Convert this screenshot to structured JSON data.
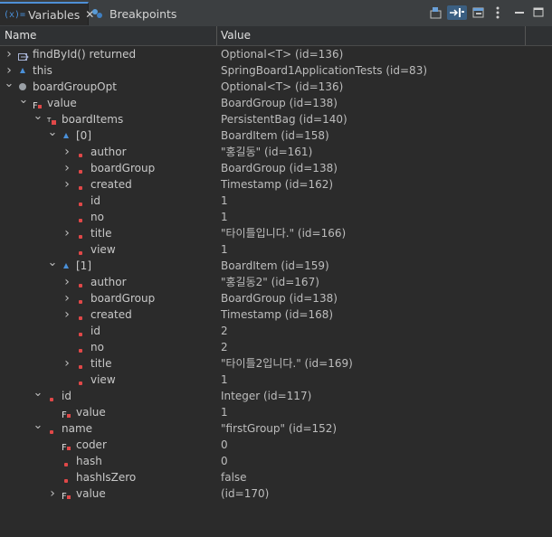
{
  "tabs": {
    "variables_label": "Variables",
    "variables_prefix": "(x)=",
    "breakpoints_label": "Breakpoints"
  },
  "columns": {
    "name": "Name",
    "value": "Value"
  },
  "rows": [
    {
      "name": "findById() returned",
      "value": "Optional<T>  (id=136)",
      "depth": 0,
      "exp": "collapsed",
      "icon": "return"
    },
    {
      "name": "this",
      "value": "SpringBoard1ApplicationTests  (id=83)",
      "depth": 0,
      "exp": "collapsed",
      "icon": "tri"
    },
    {
      "name": "boardGroupOpt",
      "value": "Optional<T>  (id=136)",
      "depth": 0,
      "exp": "expanded",
      "icon": "circle"
    },
    {
      "name": "value",
      "value": "BoardGroup  (id=138)",
      "depth": 1,
      "exp": "expanded",
      "icon": "final"
    },
    {
      "name": "boardItems",
      "value": "PersistentBag  (id=140)",
      "depth": 2,
      "exp": "expanded",
      "icon": "transient"
    },
    {
      "name": "[0]",
      "value": "BoardItem  (id=158)",
      "depth": 3,
      "exp": "expanded",
      "icon": "tri"
    },
    {
      "name": "author",
      "value": "\"홍길동\" (id=161)",
      "depth": 4,
      "exp": "collapsed",
      "icon": "red"
    },
    {
      "name": "boardGroup",
      "value": "BoardGroup  (id=138)",
      "depth": 4,
      "exp": "collapsed",
      "icon": "red"
    },
    {
      "name": "created",
      "value": "Timestamp  (id=162)",
      "depth": 4,
      "exp": "collapsed",
      "icon": "red"
    },
    {
      "name": "id",
      "value": "1",
      "depth": 4,
      "exp": "none",
      "icon": "red"
    },
    {
      "name": "no",
      "value": "1",
      "depth": 4,
      "exp": "none",
      "icon": "red"
    },
    {
      "name": "title",
      "value": "\"타이틀입니다.\" (id=166)",
      "depth": 4,
      "exp": "collapsed",
      "icon": "red"
    },
    {
      "name": "view",
      "value": "1",
      "depth": 4,
      "exp": "none",
      "icon": "red"
    },
    {
      "name": "[1]",
      "value": "BoardItem  (id=159)",
      "depth": 3,
      "exp": "expanded",
      "icon": "tri"
    },
    {
      "name": "author",
      "value": "\"홍길동2\" (id=167)",
      "depth": 4,
      "exp": "collapsed",
      "icon": "red"
    },
    {
      "name": "boardGroup",
      "value": "BoardGroup  (id=138)",
      "depth": 4,
      "exp": "collapsed",
      "icon": "red"
    },
    {
      "name": "created",
      "value": "Timestamp  (id=168)",
      "depth": 4,
      "exp": "collapsed",
      "icon": "red"
    },
    {
      "name": "id",
      "value": "2",
      "depth": 4,
      "exp": "none",
      "icon": "red"
    },
    {
      "name": "no",
      "value": "2",
      "depth": 4,
      "exp": "none",
      "icon": "red"
    },
    {
      "name": "title",
      "value": "\"타이틀2입니다.\" (id=169)",
      "depth": 4,
      "exp": "collapsed",
      "icon": "red"
    },
    {
      "name": "view",
      "value": "1",
      "depth": 4,
      "exp": "none",
      "icon": "red"
    },
    {
      "name": "id",
      "value": "Integer  (id=117)",
      "depth": 2,
      "exp": "expanded",
      "icon": "red"
    },
    {
      "name": "value",
      "value": "1",
      "depth": 3,
      "exp": "none",
      "icon": "final"
    },
    {
      "name": "name",
      "value": "\"firstGroup\" (id=152)",
      "depth": 2,
      "exp": "expanded",
      "icon": "red"
    },
    {
      "name": "coder",
      "value": "0",
      "depth": 3,
      "exp": "none",
      "icon": "final"
    },
    {
      "name": "hash",
      "value": "0",
      "depth": 3,
      "exp": "none",
      "icon": "red"
    },
    {
      "name": "hashIsZero",
      "value": "false",
      "depth": 3,
      "exp": "none",
      "icon": "red"
    },
    {
      "name": "value",
      "value": "(id=170)",
      "depth": 3,
      "exp": "collapsed",
      "icon": "final"
    }
  ]
}
